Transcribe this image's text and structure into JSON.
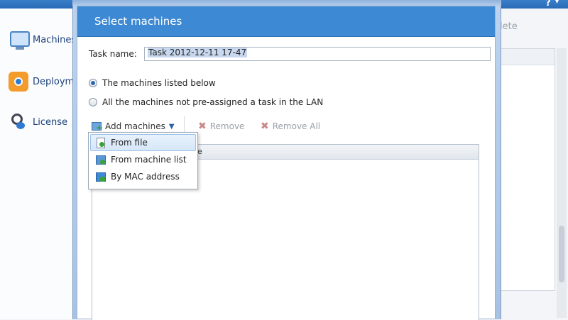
{
  "app": {
    "sidebar": {
      "items": [
        {
          "label": "Machines",
          "icon": "monitor-icon"
        },
        {
          "label": "Deployment",
          "icon": "deployment-icon"
        },
        {
          "label": "License",
          "icon": "license-icon"
        }
      ]
    },
    "toolbar_fragment": "lete",
    "help_icon": "help-icon"
  },
  "dialog": {
    "title": "Select machines",
    "task_name_label": "Task name:",
    "task_name_value": "Task 2012-12-11 17-47",
    "radios": [
      {
        "label": "The machines listed below",
        "checked": true
      },
      {
        "label": "All the machines not pre-assigned a task in the LAN",
        "checked": false
      }
    ],
    "toolbar": {
      "add_machines": "Add machines",
      "remove": "Remove",
      "remove_all": "Remove All"
    },
    "list": {
      "header_fragment": "e"
    },
    "add_menu": {
      "items": [
        {
          "label": "From file",
          "icon": "file-icon",
          "highlighted": true
        },
        {
          "label": "From machine list",
          "icon": "machine-list-icon",
          "highlighted": false
        },
        {
          "label": "By MAC address",
          "icon": "mac-address-icon",
          "highlighted": false
        }
      ]
    }
  },
  "colors": {
    "header_blue": "#3d89d4",
    "sidebar_text": "#1c3f78",
    "disabled_text": "#9aa0a8"
  }
}
